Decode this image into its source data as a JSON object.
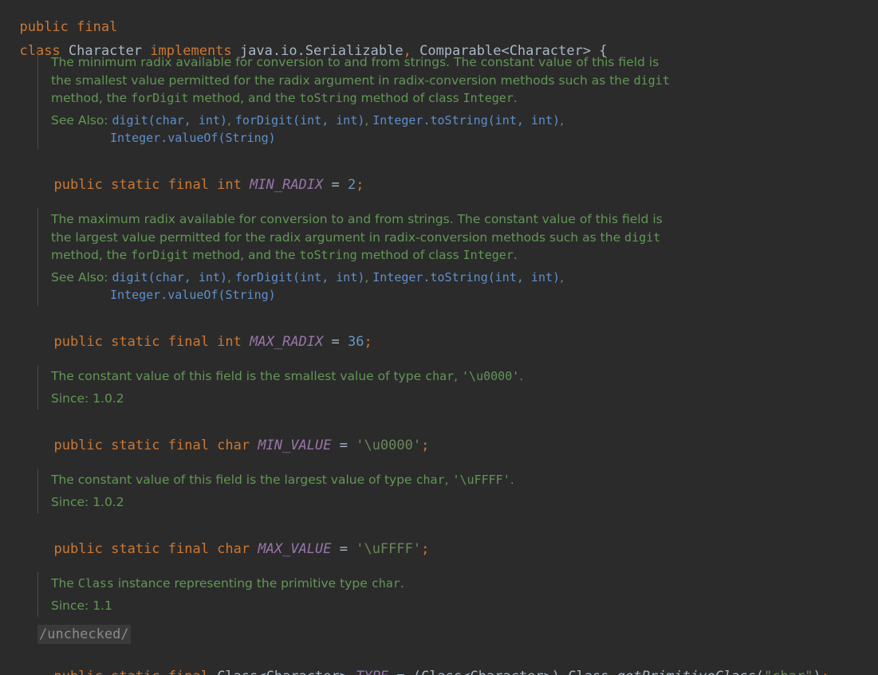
{
  "header": {
    "line1_kw": "public final",
    "line2_kw_class": "class",
    "line2_name": "Character",
    "line2_kw_implements": "implements",
    "line2_iface1": "java.io.Serializable",
    "line2_comma": ",",
    "line2_iface2": "Comparable<Character> {"
  },
  "fields": [
    {
      "doc_lines": [
        {
          "pre": "The minimum radix available for conversion to and from strings. The constant value of this field is"
        },
        {
          "pre": "the smallest value permitted for the radix argument in radix-conversion methods such as the ",
          "code": "digit"
        },
        {
          "pre": "method, the ",
          "code": "forDigit",
          "mid": " method, and the ",
          "code2": "toString",
          "mid2": " method of class ",
          "code3": "Integer",
          "post": "."
        }
      ],
      "see_also_label": "See Also:",
      "see_also_links": [
        "digit(char, int)",
        "forDigit(int, int)",
        "Integer.toString(int, int)",
        "Integer.valueOf(String)"
      ],
      "decl_kw": "public static final int",
      "decl_name": "MIN_RADIX",
      "decl_eq": " = ",
      "decl_value": "2",
      "decl_end": ";"
    },
    {
      "doc_lines": [
        {
          "pre": "The maximum radix available for conversion to and from strings. The constant value of this field is"
        },
        {
          "pre": "the largest value permitted for the radix argument in radix-conversion methods such as the ",
          "code": "digit"
        },
        {
          "pre": "method, the ",
          "code": "forDigit",
          "mid": " method, and the ",
          "code2": "toString",
          "mid2": " method of class ",
          "code3": "Integer",
          "post": "."
        }
      ],
      "see_also_label": "See Also:",
      "see_also_links": [
        "digit(char, int)",
        "forDigit(int, int)",
        "Integer.toString(int, int)",
        "Integer.valueOf(String)"
      ],
      "decl_kw": "public static final int",
      "decl_name": "MAX_RADIX",
      "decl_eq": " = ",
      "decl_value": "36",
      "decl_end": ";"
    },
    {
      "doc_pre": "The constant value of this field is the smallest value of type ",
      "doc_code": "char",
      "doc_comma": ", ",
      "doc_code2": "'\\u0000'",
      "doc_post": ".",
      "since_label": "Since:",
      "since_value": "1.0.2",
      "decl_kw": "public static final char",
      "decl_name": "MIN_VALUE",
      "decl_eq": " = ",
      "decl_value": "'\\u0000'",
      "decl_end": ";"
    },
    {
      "doc_pre": "The constant value of this field is the largest value of type ",
      "doc_code": "char",
      "doc_comma": ", ",
      "doc_code2": "'\\uFFFF'",
      "doc_post": ".",
      "since_label": "Since:",
      "since_value": "1.0.2",
      "decl_kw": "public static final char",
      "decl_name": "MAX_VALUE",
      "decl_eq": " = ",
      "decl_value": "'\\uFFFF'",
      "decl_end": ";"
    },
    {
      "doc_pre": "The ",
      "doc_code": "Class",
      "doc_mid": " instance representing the primitive type ",
      "doc_code2": "char",
      "doc_post": ".",
      "since_label": "Since:",
      "since_value": "1.1",
      "annotation": "/unchecked/",
      "decl_kw": "public static final",
      "decl_type": "Class<Character>",
      "decl_name": "TYPE",
      "decl_eq": " = ",
      "decl_cast": "(Class<Character>) Class.",
      "decl_method": "getPrimitiveClass",
      "decl_paren_open": "(",
      "decl_arg": "\"char\"",
      "decl_paren_close": ")",
      "decl_end": ";"
    }
  ]
}
